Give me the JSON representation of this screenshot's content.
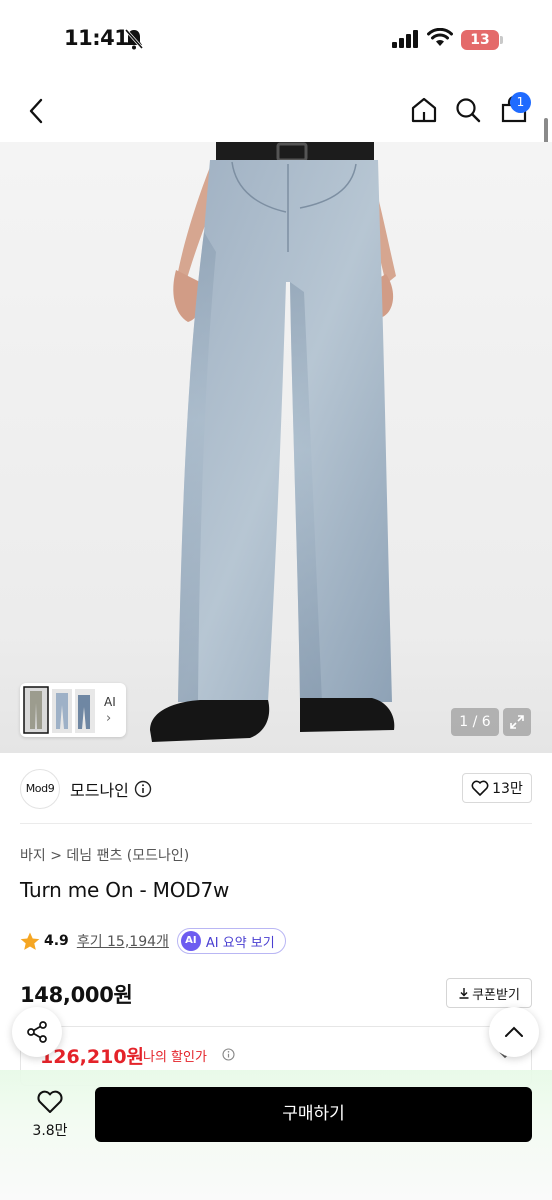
{
  "status_bar": {
    "time": "11:41",
    "battery": "13"
  },
  "nav": {
    "cart_count": "1"
  },
  "gallery": {
    "thumb_label": "AI",
    "counter": "1 / 6"
  },
  "brand": {
    "logo_text": "Mod9",
    "name": "모드나인",
    "likes": "13만"
  },
  "product": {
    "breadcrumb": "바지 > 데님 팬츠 (모드나인)",
    "title": "Turn me On - MOD7w",
    "rating": "4.9",
    "reviews": "후기 15,194개",
    "ai_summary": "AI 요약 보기",
    "ai_badge": "AI",
    "price": "148,000원",
    "coupon": "쿠폰받기",
    "discount_price": "126,210원",
    "discount_label": "나의 할인가"
  },
  "bottom": {
    "wish_count": "3.8만",
    "buy_label": "구매하기"
  },
  "colors": {
    "accent_blue": "#1f6bff",
    "discount_red": "#e4232a",
    "ai_purple": "#6d5cf0",
    "buy_black": "#000000",
    "star": "#f5a623"
  },
  "icons": [
    "bell-slash-icon",
    "signal-icon",
    "wifi-icon",
    "back-icon",
    "home-icon",
    "search-icon",
    "cart-icon",
    "expand-icon",
    "info-icon",
    "heart-icon",
    "star-icon",
    "download-icon",
    "share-icon",
    "chevron-up-icon",
    "chevron-down-icon"
  ]
}
